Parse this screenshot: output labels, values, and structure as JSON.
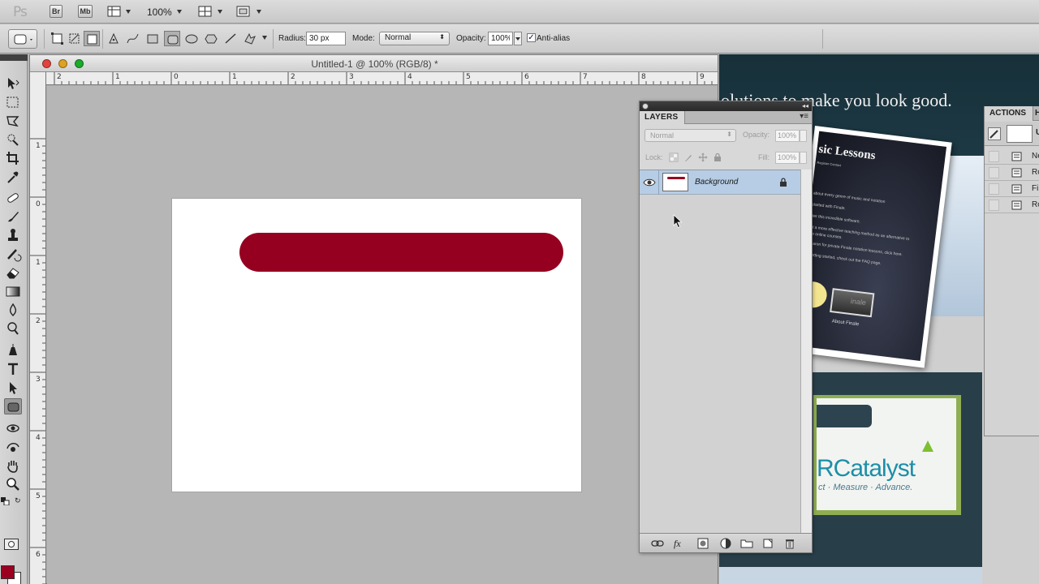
{
  "app_bar": {
    "logo": "Ps",
    "bridge_label": "Br",
    "minibridge_label": "Mb",
    "zoom": "100%"
  },
  "options_bar": {
    "radius_label": "Radius:",
    "radius_value": "30 px",
    "mode_label": "Mode:",
    "mode_value": "Normal",
    "opacity_label": "Opacity:",
    "opacity_value": "100%",
    "antialias_label": "Anti-alias",
    "antialias_checked": true
  },
  "document": {
    "title": "Untitled-1 @ 100% (RGB/8) *",
    "ruler_h_labels": [
      "2",
      "1",
      "0",
      "1",
      "2",
      "3",
      "4",
      "5",
      "6",
      "7",
      "8",
      "9"
    ],
    "ruler_v_labels": [
      "1",
      "0",
      "1",
      "2",
      "3",
      "4",
      "5",
      "6"
    ],
    "shape_color": "#950020"
  },
  "tools": {
    "foreground_color": "#9b0021",
    "background_color": "#ffffff"
  },
  "layers_panel": {
    "tab_label": "LAYERS",
    "blend_mode": "Normal",
    "opacity_label": "Opacity:",
    "opacity_value": "100%",
    "lock_label": "Lock:",
    "fill_label": "Fill:",
    "fill_value": "100%",
    "layers": [
      {
        "name": "Background",
        "visible": true,
        "locked": true,
        "selected": true
      }
    ]
  },
  "actions_panel": {
    "tab_label": "ACTIONS",
    "tab2_label": "H",
    "swatch_cut_label": "U",
    "items": [
      "Ne",
      "Ro",
      "Fil",
      "Ro"
    ]
  },
  "background_page": {
    "tagline": "olutions to make you look good.",
    "card1_title": "sic Lessons",
    "card1_nav": "Register    Contact",
    "card1_lines": [
      "about every genre of music and notation",
      "started with Finale.",
      "ster this incredible software.",
      "ed a more effective teaching method as an alternative to",
      "are online courses.",
      "y Aaron for private Finale notation lessons, click here.",
      "e getting started, check out the FAQ page."
    ],
    "card1_foot1": "essons",
    "card1_foot2": "About Finale",
    "card1_thumb_text": "inale",
    "card2_brand": "RCatalyst",
    "card2_slogan": "ct · Measure · Advance."
  }
}
